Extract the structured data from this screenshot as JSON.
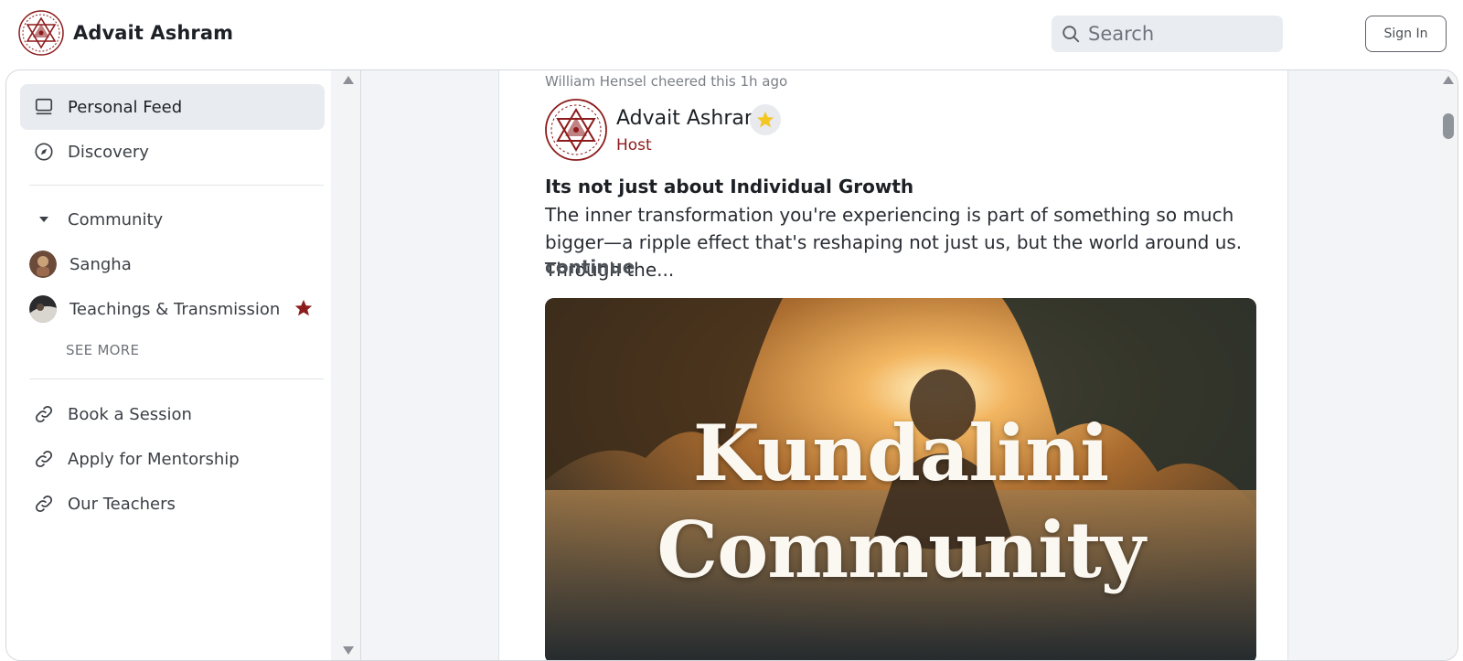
{
  "header": {
    "brand_name": "Advait Ashram",
    "search_placeholder": "Search",
    "sign_in_label": "Sign In"
  },
  "sidebar": {
    "nav": [
      {
        "label": "Personal Feed",
        "icon": "feed-icon",
        "active": true
      },
      {
        "label": "Discovery",
        "icon": "compass-icon",
        "active": false
      }
    ],
    "community_label": "Community",
    "spaces": [
      {
        "label": "Sangha",
        "icon": "space-avatar"
      },
      {
        "label": "Teachings & Transmission",
        "icon": "space-avatar",
        "starred": true
      }
    ],
    "see_more_label": "SEE MORE",
    "links": [
      {
        "label": "Book a Session",
        "icon": "link-icon"
      },
      {
        "label": "Apply for Mentorship",
        "icon": "link-icon"
      },
      {
        "label": "Our Teachers",
        "icon": "link-icon"
      }
    ]
  },
  "post": {
    "activity": "William Hensel cheered this 1h ago",
    "author_name": "Advait Ashram",
    "author_role": "Host",
    "title": "Its not just about Individual Growth",
    "body": "The inner transformation you're experiencing is part of something so much bigger—a ripple effect that's reshaping not just us, but the world around us. Through the...",
    "continue_label": "continue",
    "image_title_line1": "Kundalini",
    "image_title_line2": "Community"
  },
  "colors": {
    "brand_red": "#8d1b1b",
    "star_red": "#8c1d1d",
    "badge_gold": "#f3c623",
    "active_bg": "#e8ebef"
  }
}
